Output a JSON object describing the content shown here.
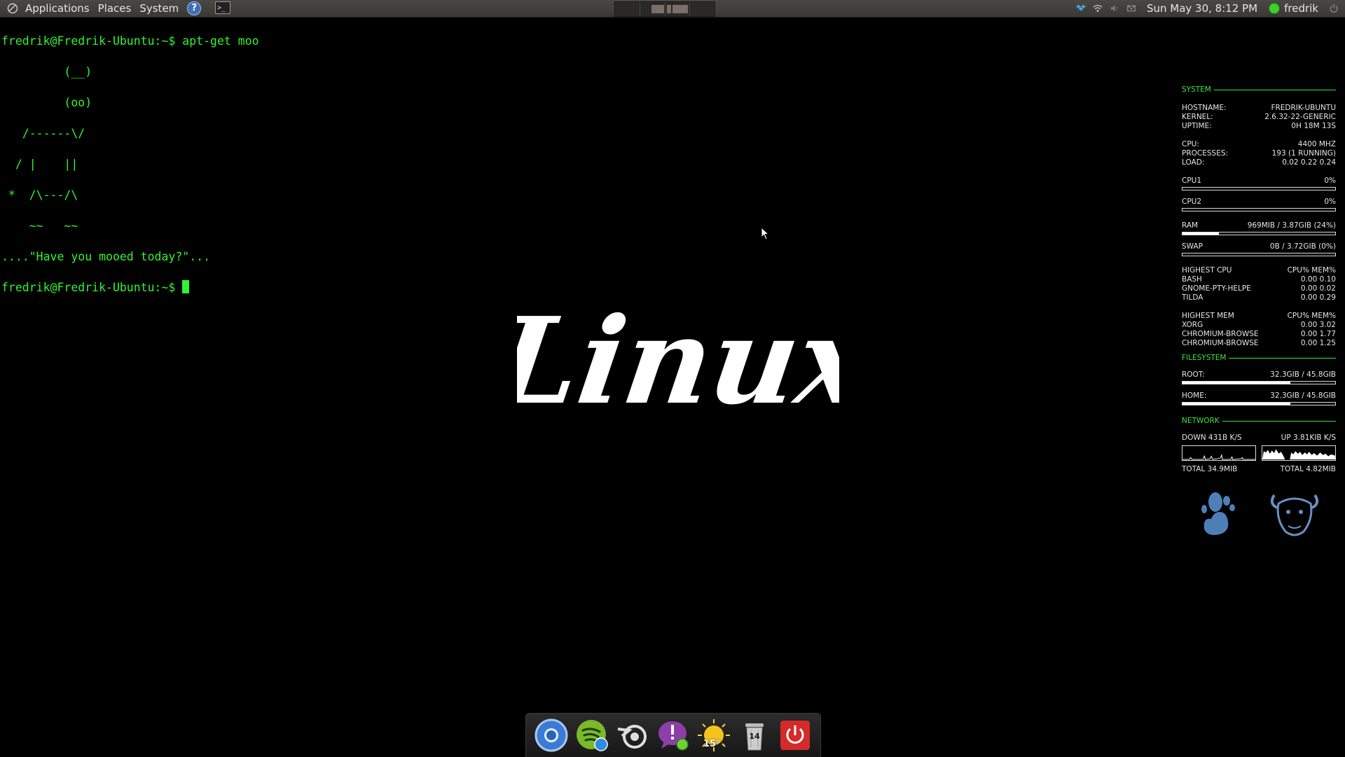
{
  "panel": {
    "menus": [
      "Applications",
      "Places",
      "System"
    ],
    "help_icon_glyph": "?",
    "terminal_launcher_glyph": ">_",
    "clock": "Sun May 30,  8:12 PM",
    "username": "fredrik",
    "tray_icons": [
      "dropbox-icon",
      "wifi-icon",
      "volume-icon",
      "mail-icon"
    ]
  },
  "terminal": {
    "lines": [
      "fredrik@Fredrik-Ubuntu:~$ apt-get moo",
      "         (__)",
      "         (oo)",
      "   /------\\/",
      "  / |    ||",
      " *  /\\---/\\",
      "    ~~   ~~",
      "....\"Have you mooed today?\"...",
      "fredrik@Fredrik-Ubuntu:~$ "
    ],
    "text_color": "#2ef52e"
  },
  "wallpaper_text": "Linux",
  "conky": {
    "system": {
      "title": "SYSTEM",
      "hostname_label": "HOSTNAME:",
      "hostname": "FREDRIK-UBUNTU",
      "kernel_label": "KERNEL:",
      "kernel": "2.6.32-22-GENERIC",
      "uptime_label": "UPTIME:",
      "uptime": "0H 18M 13S",
      "cpu_label": "CPU:",
      "cpu": "4400 MHZ",
      "processes_label": "PROCESSES:",
      "processes": "193 (1 RUNNING)",
      "load_label": "LOAD:",
      "load": "0.02 0.22 0.24",
      "cpu1_label": "CPU1",
      "cpu1": "0%",
      "cpu1_fraction": 0.0,
      "cpu2_label": "CPU2",
      "cpu2": "0%",
      "cpu2_fraction": 0.0,
      "ram_label": "RAM",
      "ram": "969MIB / 3.87GIB (24%)",
      "ram_fraction": 0.24,
      "swap_label": "SWAP",
      "swap": "0B  / 3.72GIB (0%)",
      "swap_fraction": 0.0,
      "highest_cpu": {
        "label": "HIGHEST CPU",
        "header": "CPU% MEM%",
        "rows": [
          {
            "name": "BASH",
            "values": "0.00  0.10"
          },
          {
            "name": "GNOME-PTY-HELPE",
            "values": "0.00  0.02"
          },
          {
            "name": "TILDA",
            "values": "0.00  0.29"
          }
        ]
      },
      "highest_mem": {
        "label": "HIGHEST MEM",
        "header": "CPU% MEM%",
        "rows": [
          {
            "name": "XORG",
            "values": "0.00  3.02"
          },
          {
            "name": "CHROMIUM-BROWSE",
            "values": "0.00  1.77"
          },
          {
            "name": "CHROMIUM-BROWSE",
            "values": "0.00  1.25"
          }
        ]
      }
    },
    "filesystem": {
      "title": "FILESYSTEM",
      "root_label": "ROOT:",
      "root": "32.3GIB / 45.8GIB",
      "root_fraction": 0.705,
      "home_label": "HOME:",
      "home": "32.3GIB / 45.8GIB",
      "home_fraction": 0.705
    },
    "network": {
      "title": "NETWORK",
      "down": "DOWN 431B   K/S",
      "up": "UP 3.81KIB K/S",
      "total_down": "TOTAL 34.9MIB",
      "total_up": "TOTAL 4.82MIB"
    }
  },
  "dock": {
    "items": [
      {
        "name": "chromium-browser-launcher",
        "icon": "chromium-icon"
      },
      {
        "name": "spotify-launcher",
        "icon": "spotify-icon"
      },
      {
        "name": "blender-launcher",
        "icon": "blender-icon"
      },
      {
        "name": "empathy-launcher",
        "icon": "empathy-icon"
      },
      {
        "name": "weather-launcher",
        "icon": "weather-icon",
        "label": "15°"
      },
      {
        "name": "trash-launcher",
        "icon": "trash-icon",
        "label": "14"
      },
      {
        "name": "shutdown-launcher",
        "icon": "power-icon"
      }
    ]
  }
}
